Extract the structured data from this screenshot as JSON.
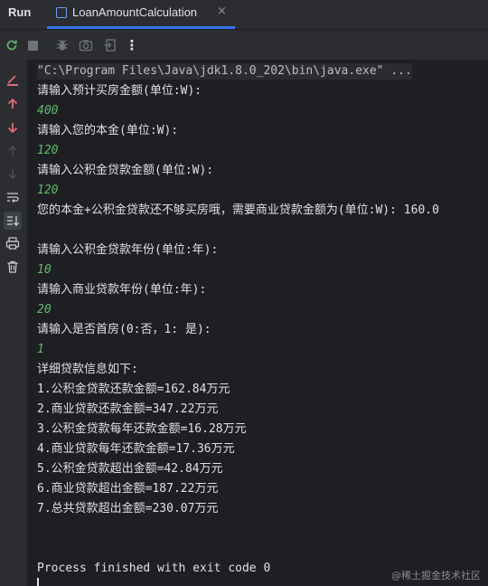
{
  "tabbar": {
    "run_label": "Run",
    "tab_title": "LoanAmountCalculation",
    "close_glyph": "×"
  },
  "toolbar": {
    "icons": [
      "rerun-icon",
      "stop-icon",
      "debug-icon",
      "screenshot-icon",
      "exit-icon",
      "more-icon"
    ],
    "more_glyph": "⋮"
  },
  "sidebar": {
    "icons": [
      "restore-layout-icon",
      "up-arrow-icon",
      "down-arrow-icon",
      "scroll-up-icon",
      "scroll-down-icon",
      "soft-wrap-icon",
      "scroll-to-end-icon",
      "print-icon",
      "trash-icon"
    ]
  },
  "console": {
    "lines": [
      {
        "type": "cmd",
        "text": "\"C:\\Program Files\\Java\\jdk1.8.0_202\\bin\\java.exe\" ..."
      },
      {
        "type": "out",
        "text": "请输入预计买房金额(单位:W):"
      },
      {
        "type": "in",
        "text": "400"
      },
      {
        "type": "out",
        "text": "请输入您的本金(单位:W):"
      },
      {
        "type": "in",
        "text": "120"
      },
      {
        "type": "out",
        "text": "请输入公积金贷款金额(单位:W):"
      },
      {
        "type": "in",
        "text": "120"
      },
      {
        "type": "out",
        "text": "您的本金+公积金贷款还不够买房哦，需要商业贷款金额为(单位:W): 160.0"
      },
      {
        "type": "out",
        "text": ""
      },
      {
        "type": "out",
        "text": "请输入公积金贷款年份(单位:年):"
      },
      {
        "type": "in",
        "text": "10"
      },
      {
        "type": "out",
        "text": "请输入商业贷款年份(单位:年):"
      },
      {
        "type": "in",
        "text": "20"
      },
      {
        "type": "out",
        "text": "请输入是否首房(0:否，1: 是):"
      },
      {
        "type": "in",
        "text": "1"
      },
      {
        "type": "out",
        "text": "详细贷款信息如下:"
      },
      {
        "type": "out",
        "text": "1.公积金贷款还款金额=162.84万元"
      },
      {
        "type": "out",
        "text": "2.商业贷款还款金额=347.22万元"
      },
      {
        "type": "out",
        "text": "3.公积金贷款每年还款金额=16.28万元"
      },
      {
        "type": "out",
        "text": "4.商业贷款每年还款金额=17.36万元"
      },
      {
        "type": "out",
        "text": "5.公积金贷款超出金额=42.84万元"
      },
      {
        "type": "out",
        "text": "6.商业贷款超出金额=187.22万元"
      },
      {
        "type": "out",
        "text": "7.总共贷款超出金额=230.07万元"
      },
      {
        "type": "out",
        "text": ""
      },
      {
        "type": "out",
        "text": ""
      },
      {
        "type": "out",
        "text": "Process finished with exit code 0"
      }
    ],
    "watermark": "@稀土掘金技术社区"
  },
  "colors": {
    "background": "#2b2d30",
    "console_bg": "#1e1f22",
    "input_text": "#5fb86c",
    "tab_underline": "#3574f0"
  }
}
